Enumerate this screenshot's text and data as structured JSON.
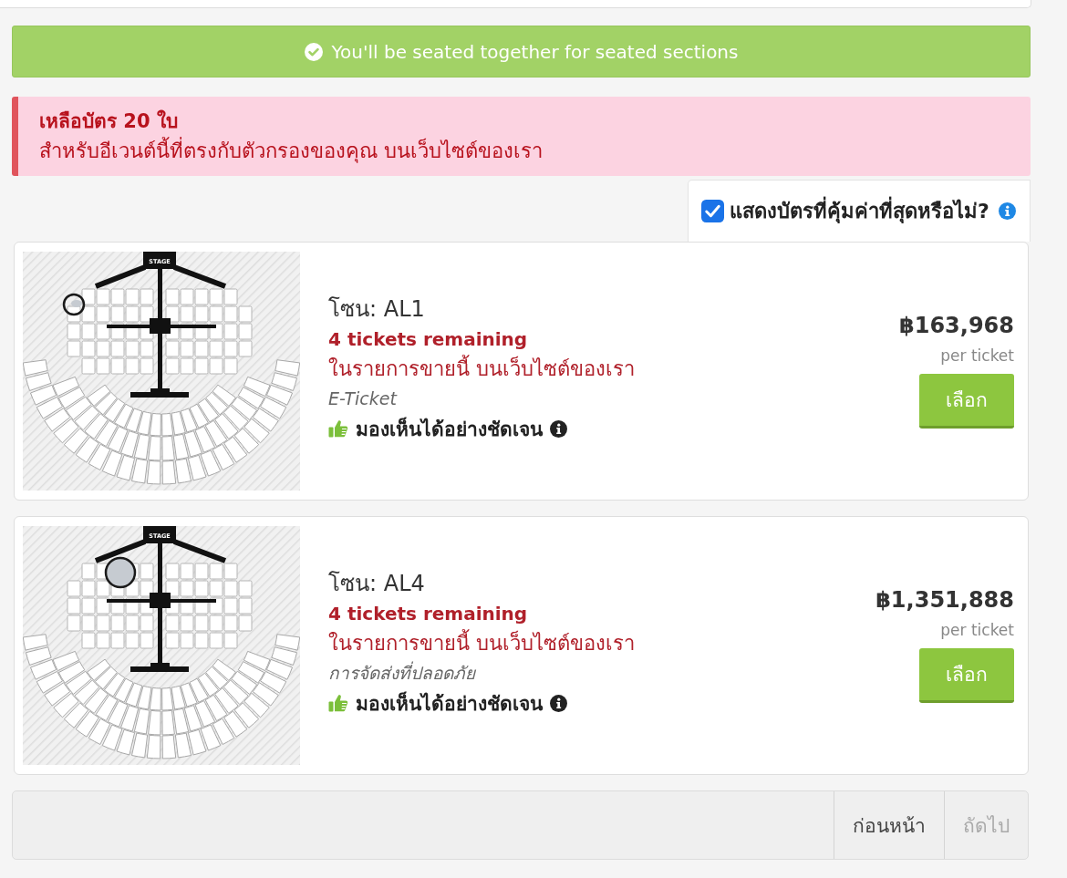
{
  "top_banner": {
    "text": "You'll be seated together for seated sections"
  },
  "alert": {
    "title": "เหลือบัตร 20 ใบ",
    "message": "สำหรับอีเวนต์นี้ที่ตรงกับตัวกรองของคุณ บนเว็บไซต์ของเรา"
  },
  "best_value_filter": {
    "label": "แสดงบัตรที่คุ้มค่าที่สุดหรือไม่?",
    "checked": true
  },
  "listings": [
    {
      "map_label": "STAGE",
      "zone": "โซน: AL1",
      "remaining": "4 tickets remaining",
      "availability_note": "ในรายการขายนี้ บนเว็บไซต์ของเรา",
      "delivery": "E-Ticket",
      "view_note": "มองเห็นได้อย่างชัดเจน",
      "price": "฿163,968",
      "price_unit": "per ticket",
      "select_button": "เลือก"
    },
    {
      "map_label": "STAGE",
      "zone": "โซน: AL4",
      "remaining": "4 tickets remaining",
      "availability_note": "ในรายการขายนี้ บนเว็บไซต์ของเรา",
      "delivery": "การจัดส่งที่ปลอดภัย",
      "view_note": "มองเห็นได้อย่างชัดเจน",
      "price": "฿1,351,888",
      "price_unit": "per ticket",
      "select_button": "เลือก"
    }
  ],
  "pagination": {
    "buttons": [
      {
        "label": "ก่อนหน้า",
        "disabled": false
      },
      {
        "label": "ถัดไป",
        "disabled": true
      }
    ]
  }
}
